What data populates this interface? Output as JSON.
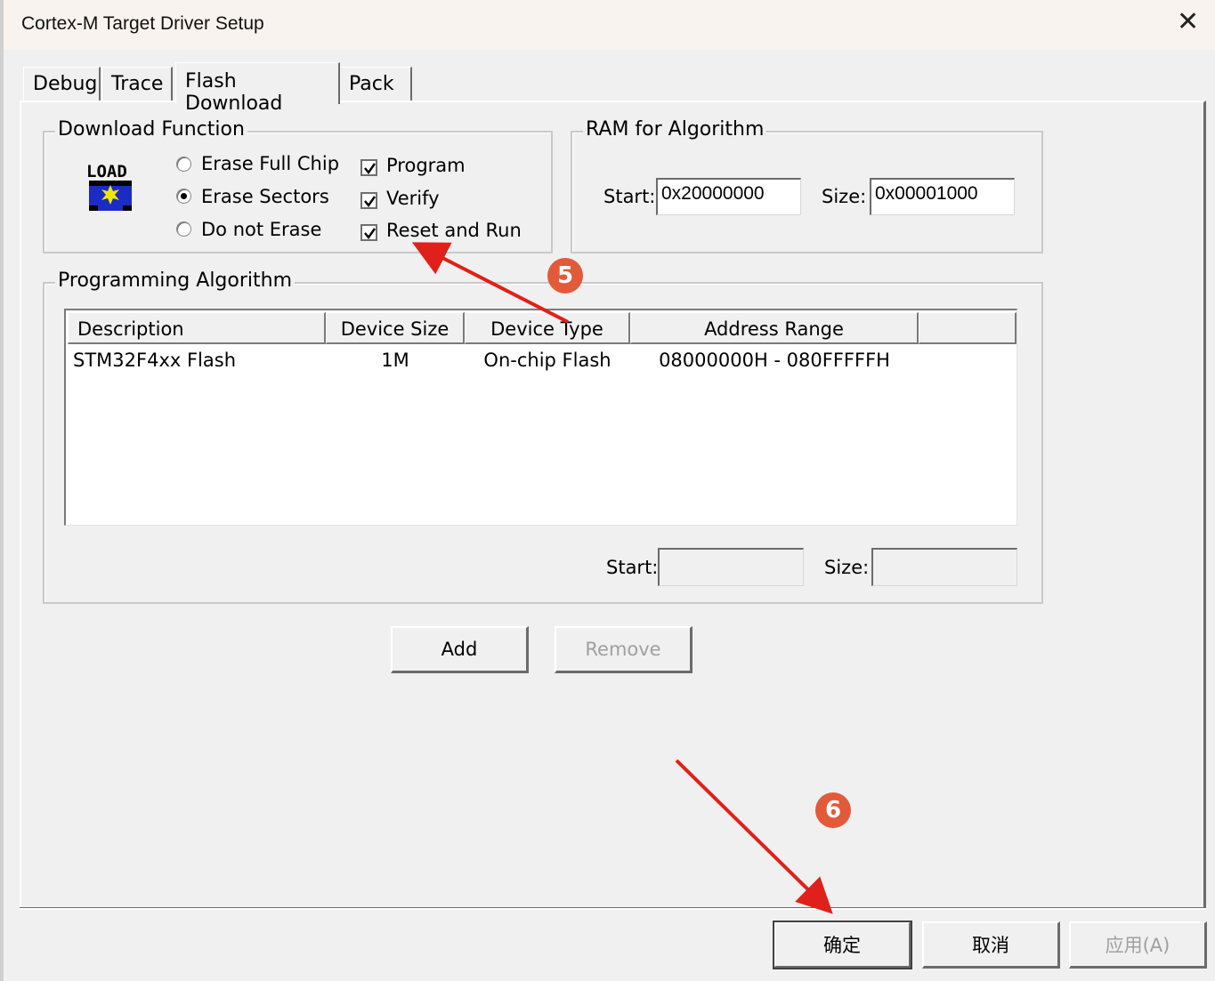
{
  "window": {
    "title": "Cortex-M Target Driver Setup",
    "close_glyph": "✕"
  },
  "tabs": [
    {
      "label": "Debug",
      "active": false
    },
    {
      "label": "Trace",
      "active": false
    },
    {
      "label": "Flash Download",
      "active": true
    },
    {
      "label": "Pack",
      "active": false
    }
  ],
  "download_function": {
    "title": "Download Function",
    "logo_text": "LOAD",
    "erase_options": [
      {
        "label": "Erase Full Chip",
        "selected": false
      },
      {
        "label": "Erase Sectors",
        "selected": true
      },
      {
        "label": "Do not Erase",
        "selected": false
      }
    ],
    "checkboxes": [
      {
        "label": "Program",
        "checked": true
      },
      {
        "label": "Verify",
        "checked": true
      },
      {
        "label": "Reset and Run",
        "checked": true
      }
    ]
  },
  "ram_for_algorithm": {
    "title": "RAM for Algorithm",
    "start_label": "Start:",
    "start_value": "0x20000000",
    "size_label": "Size:",
    "size_value": "0x00001000"
  },
  "programming_algorithm": {
    "title": "Programming Algorithm",
    "columns": [
      "Description",
      "Device Size",
      "Device Type",
      "Address Range"
    ],
    "rows": [
      {
        "description": "STM32F4xx Flash",
        "device_size": "1M",
        "device_type": "On-chip Flash",
        "address_range": "08000000H - 080FFFFFH"
      }
    ],
    "start_label": "Start:",
    "start_value": "",
    "size_label": "Size:",
    "size_value": ""
  },
  "buttons": {
    "add": "Add",
    "remove": "Remove",
    "ok": "确定",
    "cancel": "取消",
    "apply": "应用(A)"
  },
  "annotations": {
    "step5": "5",
    "step6": "6",
    "color": "#e25a3a",
    "arrow_color": "#e0201a"
  }
}
